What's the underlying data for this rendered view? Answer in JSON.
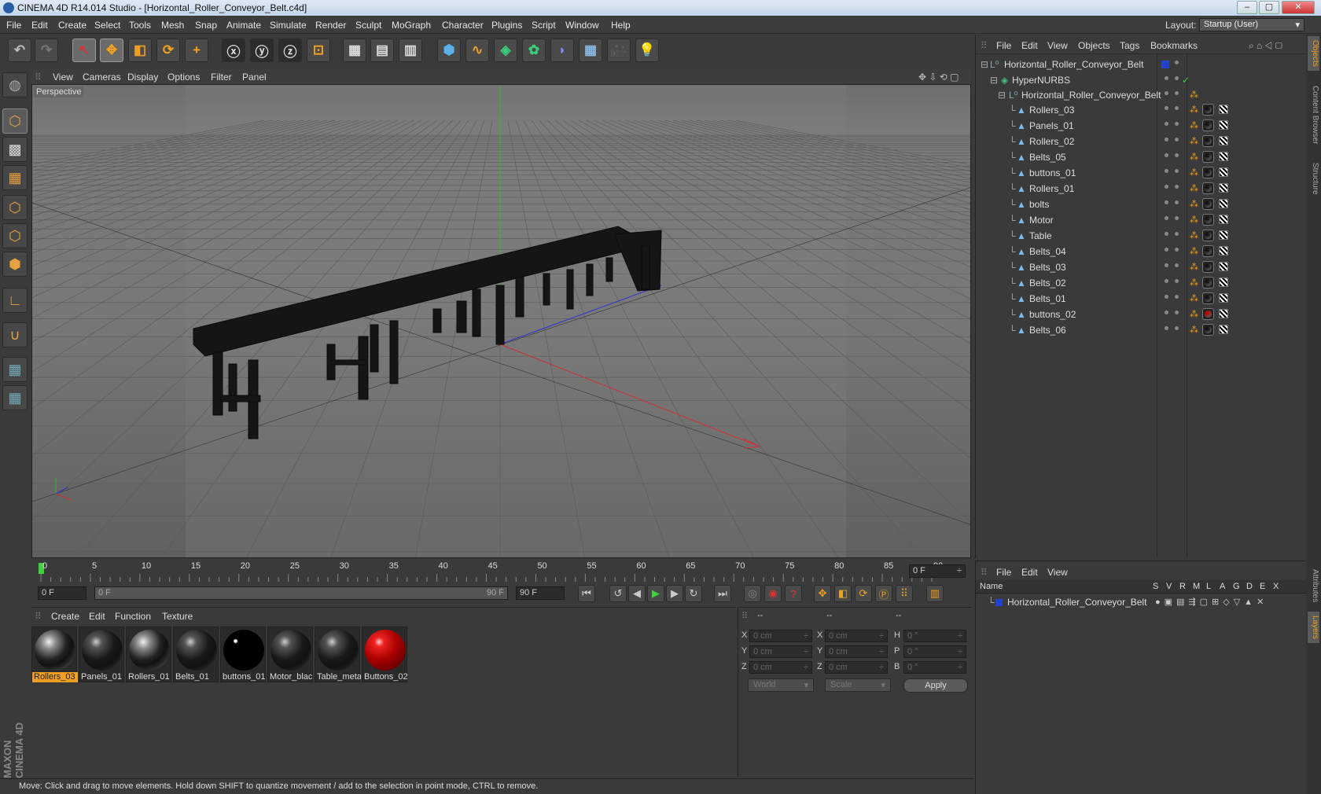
{
  "window": {
    "title": "CINEMA 4D R14.014 Studio - [Horizontal_Roller_Conveyor_Belt.c4d]",
    "min": "–",
    "max": "▢",
    "close": "✕"
  },
  "menu": [
    "File",
    "Edit",
    "Create",
    "Select",
    "Tools",
    "Mesh",
    "Snap",
    "Animate",
    "Simulate",
    "Render",
    "Sculpt",
    "MoGraph",
    "Character",
    "Plugins",
    "Script",
    "Window",
    "Help"
  ],
  "layout": {
    "label": "Layout:",
    "value": "Startup (User)"
  },
  "toolbar_icons": [
    "undo-icon",
    "redo-icon",
    "live-selection-icon",
    "move-icon",
    "scale-icon",
    "rotate-icon",
    "add-icon",
    "x-axis-icon",
    "y-axis-icon",
    "z-axis-icon",
    "coordinate-system-icon",
    "render-view-icon",
    "render-picture-viewer-icon",
    "render-settings-icon",
    "cube-icon",
    "spline-icon",
    "nurbs-icon",
    "array-icon",
    "deformer-icon",
    "floor-icon",
    "camera-icon",
    "light-icon"
  ],
  "viewport": {
    "menu": [
      "View",
      "Cameras",
      "Display",
      "Options",
      "Filter",
      "Panel"
    ],
    "label": "Perspective"
  },
  "timeline": {
    "ticks": [
      "0",
      "5",
      "10",
      "15",
      "20",
      "25",
      "30",
      "35",
      "40",
      "45",
      "50",
      "55",
      "60",
      "65",
      "70",
      "75",
      "80",
      "85",
      "90"
    ],
    "frame_end_field": "0 F"
  },
  "playbar": {
    "start": "0 F",
    "range_start": "0 F",
    "range_end": "90 F",
    "end": "90 F"
  },
  "materials": {
    "menu": [
      "Create",
      "Edit",
      "Function",
      "Texture"
    ],
    "items": [
      {
        "name": "Rollers_03",
        "style": "chrome",
        "selected": true
      },
      {
        "name": "Panels_01",
        "style": "dark"
      },
      {
        "name": "Rollers_01",
        "style": "chrome"
      },
      {
        "name": "Belts_01",
        "style": "dark"
      },
      {
        "name": "buttons_01",
        "style": "black"
      },
      {
        "name": "Motor_blac",
        "style": "dark"
      },
      {
        "name": "Table_meta",
        "style": "dark"
      },
      {
        "name": "Buttons_02",
        "style": "red"
      }
    ]
  },
  "coords": {
    "header": [
      "--",
      "--",
      "--"
    ],
    "rows": [
      {
        "a": "X",
        "av": "0 cm",
        "b": "X",
        "bv": "0 cm",
        "c": "H",
        "cv": "0 °"
      },
      {
        "a": "Y",
        "av": "0 cm",
        "b": "Y",
        "bv": "0 cm",
        "c": "P",
        "cv": "0 °"
      },
      {
        "a": "Z",
        "av": "0 cm",
        "b": "Z",
        "bv": "0 cm",
        "c": "B",
        "cv": "0 °"
      }
    ],
    "space": "World",
    "mode": "Scale",
    "apply": "Apply"
  },
  "objects": {
    "menu": [
      "File",
      "Edit",
      "View",
      "Objects",
      "Tags",
      "Bookmarks"
    ],
    "root": "Horizontal_Roller_Conveyor_Belt",
    "hypernurbs": "HyperNURBS",
    "group": "Horizontal_Roller_Conveyor_Belt",
    "children": [
      "Rollers_03",
      "Panels_01",
      "Rollers_02",
      "Belts_05",
      "buttons_01",
      "Rollers_01",
      "bolts",
      "Motor",
      "Table",
      "Belts_04",
      "Belts_03",
      "Belts_02",
      "Belts_01",
      "buttons_02",
      "Belts_06"
    ]
  },
  "layers": {
    "menu": [
      "File",
      "Edit",
      "View"
    ],
    "col_name": "Name",
    "cols": [
      "S",
      "V",
      "R",
      "M",
      "L",
      "A",
      "G",
      "D",
      "E",
      "X"
    ],
    "row": "Horizontal_Roller_Conveyor_Belt"
  },
  "side_tabs": [
    "Objects",
    "Content Browser",
    "Structure",
    "Attributes",
    "Layers"
  ],
  "status": "Move: Click and drag to move elements. Hold down SHIFT to quantize movement / add to the selection in point mode, CTRL to remove.",
  "brand": "MAXON CINEMA 4D"
}
